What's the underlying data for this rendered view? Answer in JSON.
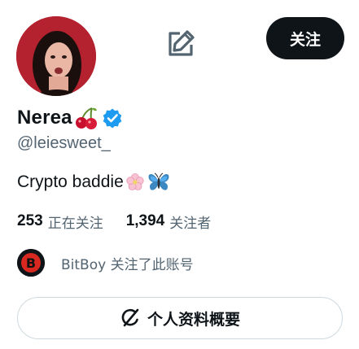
{
  "profile": {
    "display_name": "Nerea",
    "handle": "@leiesweet_",
    "bio_text": "Crypto baddie",
    "name_emoji": "cherry-icon",
    "verified": true,
    "bio_emojis": [
      "blossom-icon",
      "butterfly-icon"
    ]
  },
  "actions": {
    "follow_label": "关注",
    "edit_icon": "edit-icon"
  },
  "stats": {
    "following_count": "253",
    "following_label": "正在关注",
    "followers_count": "1,394",
    "followers_label": "关注者"
  },
  "followed_by": {
    "text": "BitBoy 关注了此账号"
  },
  "overview": {
    "label": "个人资料概要",
    "icon": "grok-icon"
  },
  "colors": {
    "text_primary": "#0f1419",
    "text_secondary": "#536471",
    "verified_blue": "#1d9bf0",
    "button_dark": "#0f1419",
    "border": "#cfd9de"
  }
}
